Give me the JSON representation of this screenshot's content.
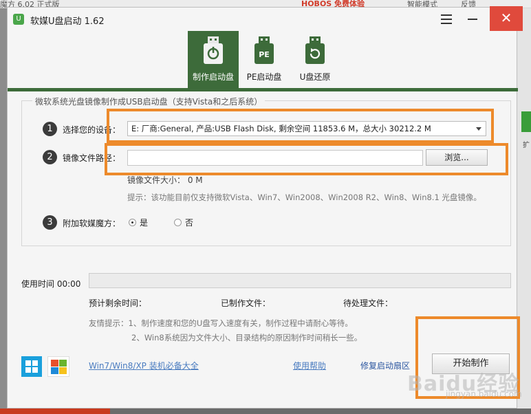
{
  "background": {
    "left_title": "魔方 6.02 正式版",
    "brand_text": "HOBOS 免费体验",
    "menu1": "智能模式",
    "menu2": "反馈",
    "right_label": "扩"
  },
  "window": {
    "title": "软媒U盘启动 1.62",
    "close_glyph": "✕",
    "logo_glyph": "U"
  },
  "tabs": [
    {
      "label": "制作启动盘",
      "active": true
    },
    {
      "label": "PE启动盘",
      "active": false
    },
    {
      "label": "U盘还原",
      "active": false
    }
  ],
  "group_title": "微软系统光盘镜像制作成USB启动盘（支持Vista和之后系统）",
  "steps": {
    "s1": {
      "num": "1",
      "label": "选择您的设备：",
      "value": "E: 厂商:General, 产品:USB Flash Disk, 剩余空间 11853.6 M，总大小 30212.2 M"
    },
    "s2": {
      "num": "2",
      "label": "镜像文件路径：",
      "placeholder": "",
      "browse": "浏览..."
    },
    "size_text": "镜像文件大小：   0 M",
    "hint": "提示：该功能目前仅支持微软Vista、Win7、Win2008、Win2008 R2、Win8、Win8.1 光盘镜像。",
    "s3": {
      "num": "3",
      "label": "附加软媒魔方：",
      "opt_yes": "是",
      "opt_no": "否",
      "selected": "是"
    }
  },
  "progress": {
    "time_label": "使用时间 00:00",
    "value": 0,
    "remaining": "预计剩余时间：",
    "made": "已制作文件：",
    "pending": "待处理文件："
  },
  "tips": {
    "line1": "友情提示：1、制作速度和您的U盘写入速度有关，制作过程中请耐心等待。",
    "line2": "2、Win8系统因为文件大小、目录结构的原因制作时间稍长一些。"
  },
  "footer": {
    "link_all": "Win7/Win8/XP 装机必备大全",
    "help": "使用帮助",
    "repair": "修复启动扇区",
    "start": "开始制作"
  },
  "watermark": {
    "text": "Baidu经验",
    "url": "jingyan.baidu.com"
  },
  "colors": {
    "accent_green": "#3d6b3a",
    "highlight_orange": "#ed8a2b",
    "close_red": "#e04a3c"
  }
}
